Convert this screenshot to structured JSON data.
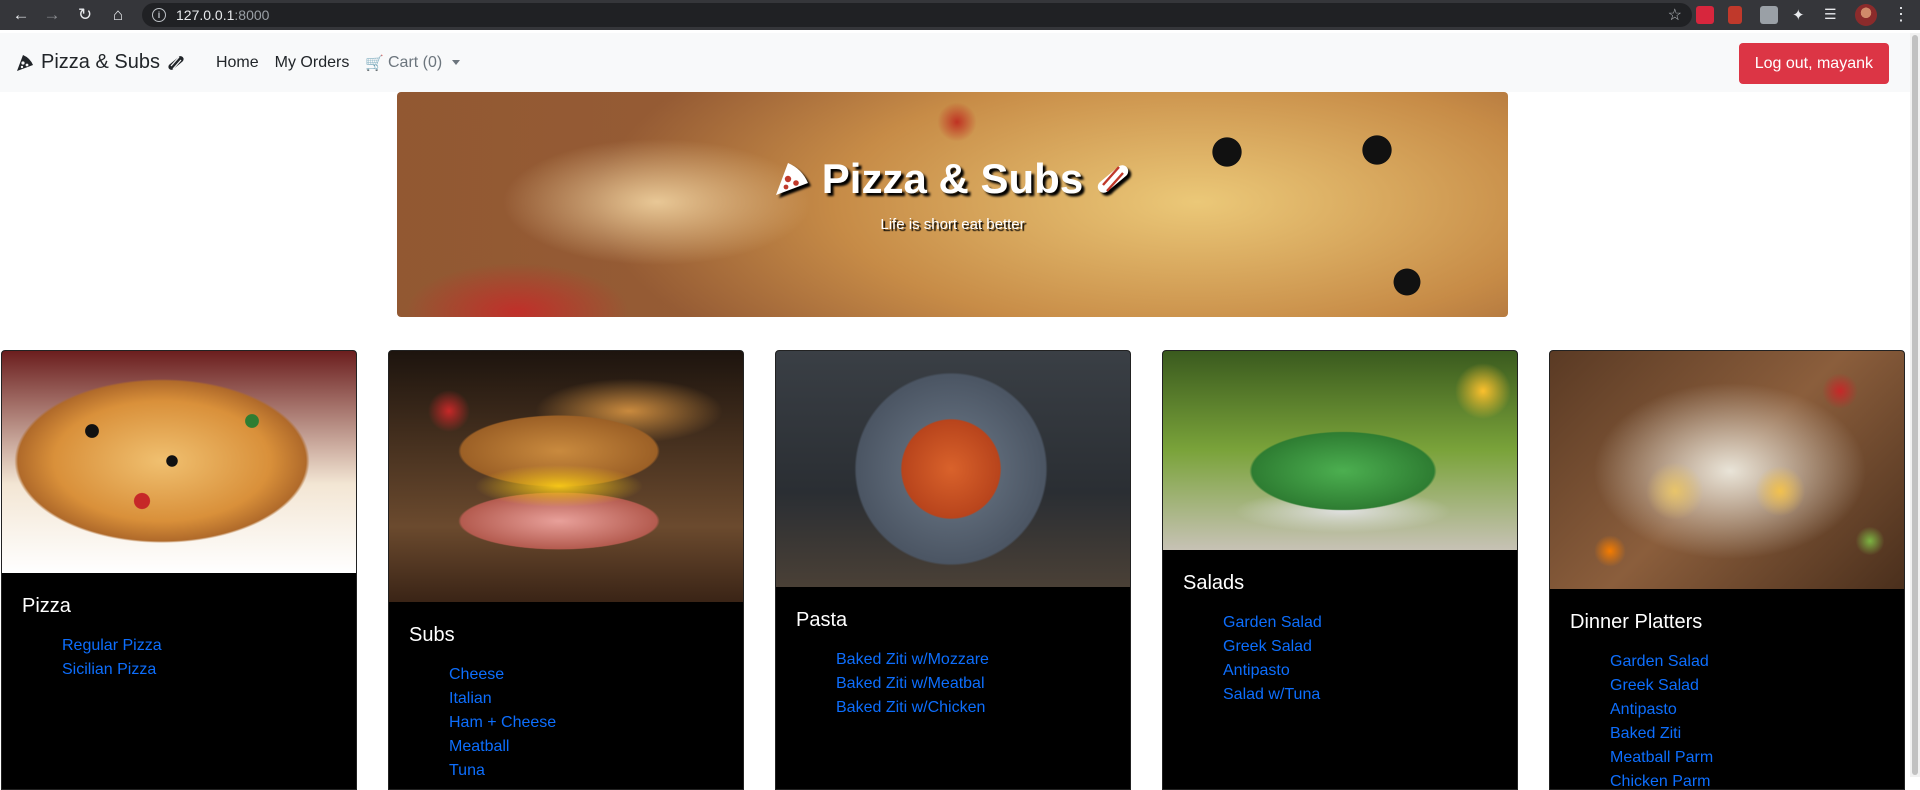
{
  "browser": {
    "url_host": "127.0.0.1",
    "url_port": ":8000"
  },
  "navbar": {
    "brand": "Pizza & Subs",
    "links": [
      "Home",
      "My Orders"
    ],
    "cart_label": "Cart (0)",
    "logout_label": "Log out, mayank"
  },
  "banner": {
    "title": "Pizza & Subs",
    "subtitle": "Life is short eat better"
  },
  "categories": [
    {
      "title": "Pizza",
      "items": [
        "Regular Pizza",
        "Sicilian Pizza"
      ]
    },
    {
      "title": "Subs",
      "items": [
        "Cheese",
        "Italian",
        "Ham + Cheese",
        "Meatball",
        "Tuna"
      ]
    },
    {
      "title": "Pasta",
      "items": [
        "Baked Ziti w/Mozzare",
        "Baked Ziti w/Meatbal",
        "Baked Ziti w/Chicken"
      ]
    },
    {
      "title": "Salads",
      "items": [
        "Garden Salad",
        "Greek Salad",
        "Antipasto",
        "Salad w/Tuna"
      ]
    },
    {
      "title": "Dinner Platters",
      "items": [
        "Garden Salad",
        "Greek Salad",
        "Antipasto",
        "Baked Ziti",
        "Meatball Parm",
        "Chicken Parm"
      ]
    }
  ],
  "colors": {
    "link": "#0d6efd",
    "logout_bg": "#dc3545",
    "navbar_bg": "#f8f9fa",
    "card_bg": "#000000"
  }
}
